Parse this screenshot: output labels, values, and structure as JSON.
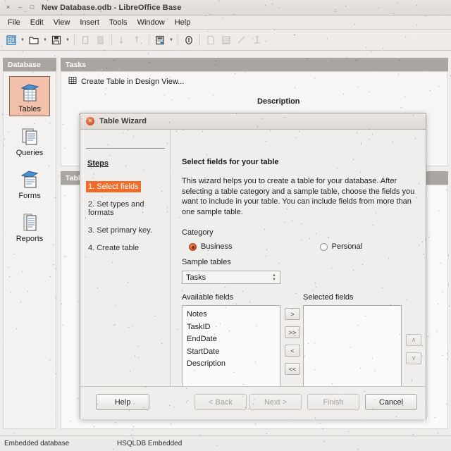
{
  "window": {
    "title": "New Database.odb - LibreOffice Base",
    "close_glyph": "×",
    "minimize_glyph": "–",
    "maximize_glyph": "□"
  },
  "menubar": {
    "items": [
      {
        "label": "File"
      },
      {
        "label": "Edit"
      },
      {
        "label": "View"
      },
      {
        "label": "Insert"
      },
      {
        "label": "Tools"
      },
      {
        "label": "Window"
      },
      {
        "label": "Help"
      }
    ]
  },
  "toolbar": {
    "items": [
      {
        "name": "new-database-icon",
        "enabled": true
      },
      {
        "name": "open-file-icon",
        "enabled": true
      },
      {
        "name": "save-icon",
        "enabled": true
      },
      {
        "name": "cut-icon",
        "enabled": false
      },
      {
        "name": "copy-icon",
        "enabled": false
      },
      {
        "name": "sort-ascending-icon",
        "enabled": false
      },
      {
        "name": "sort-descending-icon",
        "enabled": false
      },
      {
        "name": "form-wizard-icon",
        "enabled": true
      },
      {
        "name": "info-icon",
        "enabled": true
      },
      {
        "name": "new-document-icon",
        "enabled": false
      },
      {
        "name": "table-icon",
        "enabled": false
      },
      {
        "name": "query-icon",
        "enabled": false
      },
      {
        "name": "relationships-icon",
        "enabled": false
      }
    ]
  },
  "database_pane": {
    "header": "Database",
    "items": [
      {
        "label": "Tables",
        "icon": "tables-icon",
        "selected": true
      },
      {
        "label": "Queries",
        "icon": "queries-icon",
        "selected": false
      },
      {
        "label": "Forms",
        "icon": "forms-icon",
        "selected": false
      },
      {
        "label": "Reports",
        "icon": "reports-icon",
        "selected": false
      }
    ]
  },
  "tasks_pane": {
    "header": "Tasks",
    "description_column": "Description",
    "items": [
      {
        "label": "Create Table in Design View...",
        "icon": "design-view-icon"
      }
    ]
  },
  "tables_pane": {
    "header": "Tables"
  },
  "statusbar": {
    "left": "Embedded database",
    "middle": "HSQLDB Embedded"
  },
  "dialog": {
    "title": "Table Wizard",
    "steps_header": "Steps",
    "steps": [
      {
        "label": "1. Select fields",
        "active": true
      },
      {
        "label": "2. Set types and formats",
        "active": false
      },
      {
        "label": "3. Set primary key.",
        "active": false
      },
      {
        "label": "4. Create table",
        "active": false
      }
    ],
    "content_title": "Select fields for your table",
    "content_description": "This wizard helps you to create a table for your database. After selecting a table category and a sample table, choose the fields you want to include in your table. You can include fields from more than one sample table.",
    "category_label": "Category",
    "category_options": [
      {
        "label": "Business",
        "selected": true
      },
      {
        "label": "Personal",
        "selected": false
      }
    ],
    "sample_tables_label": "Sample tables",
    "sample_tables_value": "Tasks",
    "available_fields_label": "Available fields",
    "available_fields": [
      "Notes",
      "TaskID",
      "EndDate",
      "StartDate",
      "Description"
    ],
    "selected_fields_label": "Selected fields",
    "selected_fields": [],
    "transfer_buttons": [
      {
        "label": ">",
        "name": "move-right-button",
        "enabled": true
      },
      {
        "label": ">>",
        "name": "move-all-right-button",
        "enabled": true
      },
      {
        "label": "<",
        "name": "move-left-button",
        "enabled": true
      },
      {
        "label": "<<",
        "name": "move-all-left-button",
        "enabled": true
      }
    ],
    "order_buttons": [
      {
        "label": "∧",
        "name": "move-up-button",
        "enabled": false
      },
      {
        "label": "∨",
        "name": "move-down-button",
        "enabled": false
      }
    ],
    "footer_buttons": [
      {
        "label": "Help",
        "name": "help-button",
        "enabled": true
      },
      {
        "label": "< Back",
        "name": "back-button",
        "enabled": false
      },
      {
        "label": "Next >",
        "name": "next-button",
        "enabled": false
      },
      {
        "label": "Finish",
        "name": "finish-button",
        "enabled": false
      },
      {
        "label": "Cancel",
        "name": "cancel-button",
        "enabled": true
      }
    ]
  },
  "colors": {
    "accent_orange": "#ef6c2b",
    "selection_pink": "#f2c0ab",
    "pane_header": "#a9a5a1",
    "window_bg": "#efedec"
  }
}
